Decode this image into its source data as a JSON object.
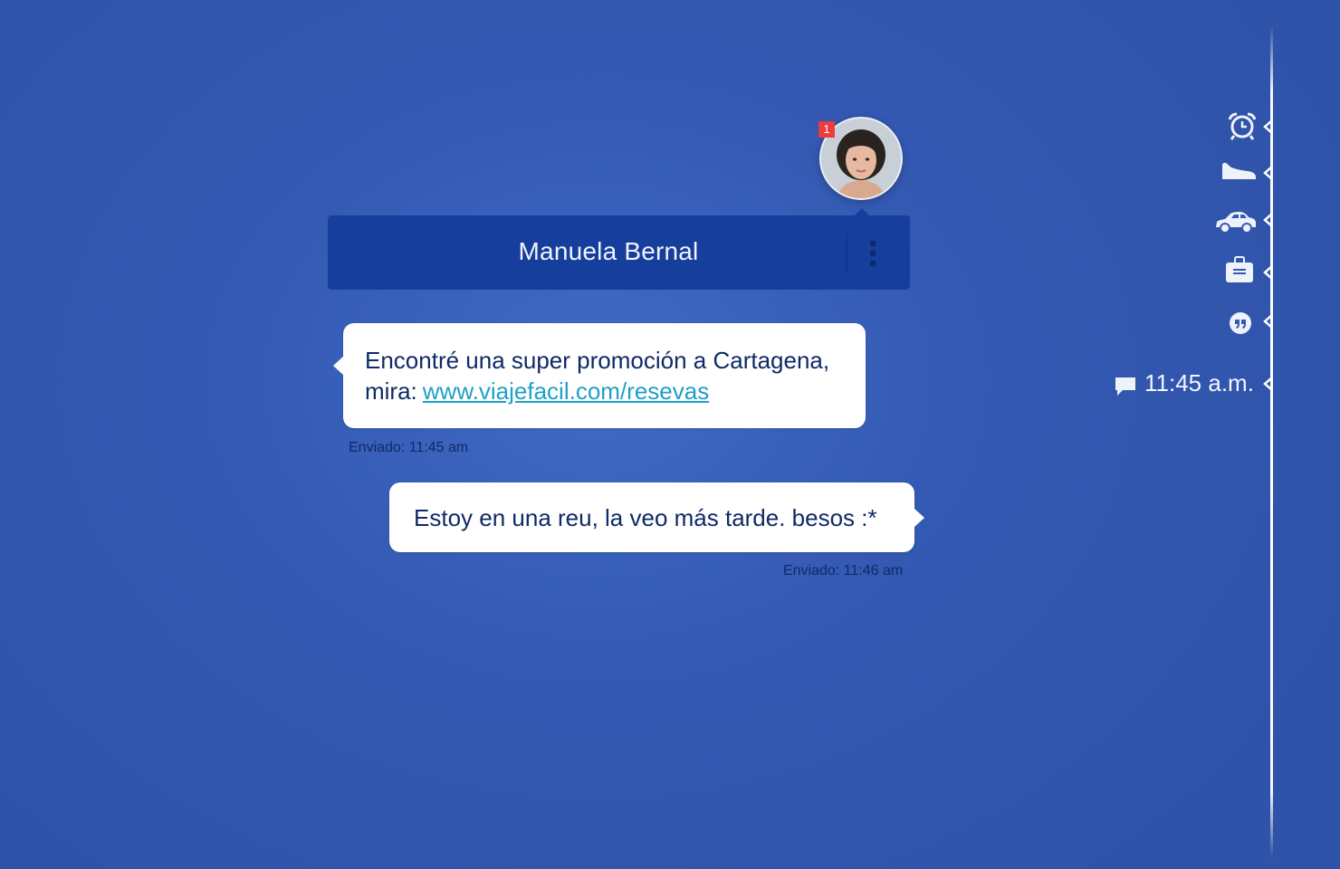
{
  "contact": {
    "name": "Manuela Bernal",
    "unread_count": "1"
  },
  "messages": [
    {
      "direction": "incoming",
      "text": "Encontré una super promoción a Cartagena, mira:",
      "link": "www.viajefacil.com/resevas",
      "status": "Enviado: 11:45 am"
    },
    {
      "direction": "outgoing",
      "text": "Estoy en una reu, la veo más tarde. besos :*",
      "status": "Enviado: 11:46 am"
    }
  ],
  "timeline": {
    "items": [
      {
        "icon": "alarm-clock-icon"
      },
      {
        "icon": "shoe-icon"
      },
      {
        "icon": "car-icon"
      },
      {
        "icon": "briefcase-icon"
      },
      {
        "icon": "quote-icon"
      },
      {
        "icon": "chat-icon",
        "label": "11:45 a.m."
      }
    ]
  },
  "colors": {
    "background": "#3459b3",
    "header": "#163e9c",
    "bubble": "#ffffff",
    "text": "#0f2a66",
    "link": "#1ea0c8",
    "badge": "#ee3b3b"
  }
}
